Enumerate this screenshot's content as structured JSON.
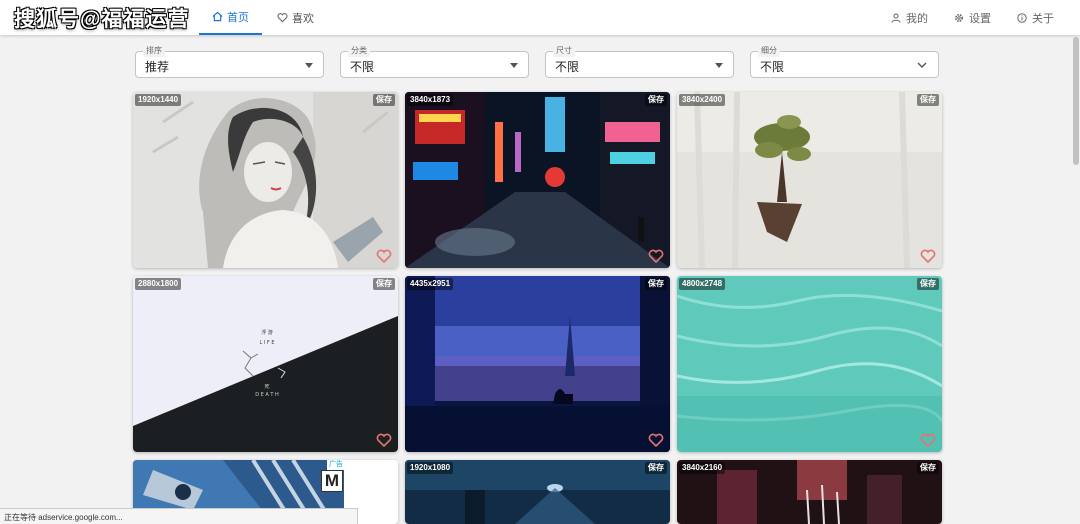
{
  "watermark": "搜狐号@福福运营",
  "nav": {
    "tabs": [
      {
        "label": "首页",
        "icon": "home-icon",
        "active": true
      },
      {
        "label": "喜欢",
        "icon": "heart-outline-icon",
        "active": false
      }
    ],
    "right": [
      {
        "label": "我的",
        "icon": "person-icon"
      },
      {
        "label": "设置",
        "icon": "gear-icon"
      },
      {
        "label": "关于",
        "icon": "info-icon"
      }
    ]
  },
  "filters": [
    {
      "label": "排序",
      "value": "推荐"
    },
    {
      "label": "分类",
      "value": "不限"
    },
    {
      "label": "尺寸",
      "value": "不限"
    },
    {
      "label": "细分",
      "value": "不限"
    }
  ],
  "wallpapers": [
    {
      "resolution": "1920x1440",
      "save": "保存",
      "subject": "anime-girl-sketch"
    },
    {
      "resolution": "3840x1873",
      "save": "保存",
      "subject": "cyberpunk-street"
    },
    {
      "resolution": "3840x2400",
      "save": "保存",
      "subject": "floating-island-tree"
    },
    {
      "resolution": "2880x1800",
      "save": "保存",
      "subject": "life-death-minimal",
      "art_text": [
        "浮 游",
        "L I F E",
        "死",
        "D E A T H"
      ]
    },
    {
      "resolution": "4435x2951",
      "save": "保存",
      "subject": "paris-night-cat"
    },
    {
      "resolution": "4800x2748",
      "save": "保存",
      "subject": "turquoise-water"
    },
    {
      "resolution": "",
      "save": "",
      "subject": "advertisement",
      "ad_label": "广告",
      "ad_logo": "M"
    },
    {
      "resolution": "1920x1080",
      "save": "保存",
      "subject": "night-scene"
    },
    {
      "resolution": "3840x2160",
      "save": "保存",
      "subject": "neon-alley"
    }
  ],
  "status_bar": "正在等待 adservice.google.com...",
  "colors": {
    "accent": "#1976d2",
    "background": "#f2f2f2",
    "heart": "#e57373"
  }
}
